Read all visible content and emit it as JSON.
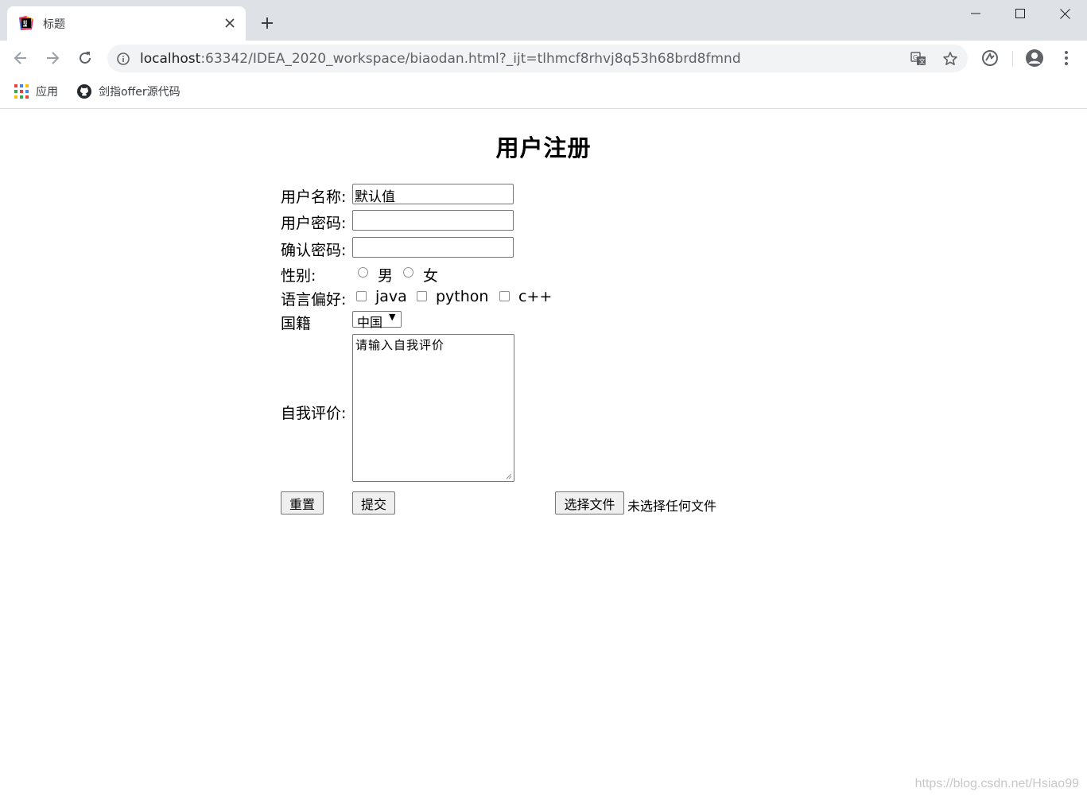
{
  "browser": {
    "tab_title": "标题",
    "url_host": "localhost",
    "url_rest": ":63342/IDEA_2020_workspace/biaodan.html?_ijt=tlhmcf8rhvj8q53h68brd8fmnd",
    "bookmarks": [
      {
        "label": "应用",
        "icon": "apps-grid-icon"
      },
      {
        "label": "剑指offer源代码",
        "icon": "github-icon"
      }
    ]
  },
  "form": {
    "title": "用户注册",
    "username_label": "用户名称:",
    "username_value": "默认值",
    "password_label": "用户密码:",
    "confirm_label": "确认密码:",
    "gender_label": "性别:",
    "gender_options": [
      "男",
      "女"
    ],
    "lang_label": "语言偏好:",
    "lang_options": [
      "java",
      "python",
      "c++"
    ],
    "nationality_label": "国籍",
    "nationality_selected": "中国",
    "self_eval_label": "自我评价:",
    "self_eval_value": "请输入自我评价",
    "reset_label": "重置",
    "submit_label": "提交",
    "file_button_label": "选择文件",
    "file_status": "未选择任何文件"
  },
  "watermark": "https://blog.csdn.net/Hsiao99"
}
